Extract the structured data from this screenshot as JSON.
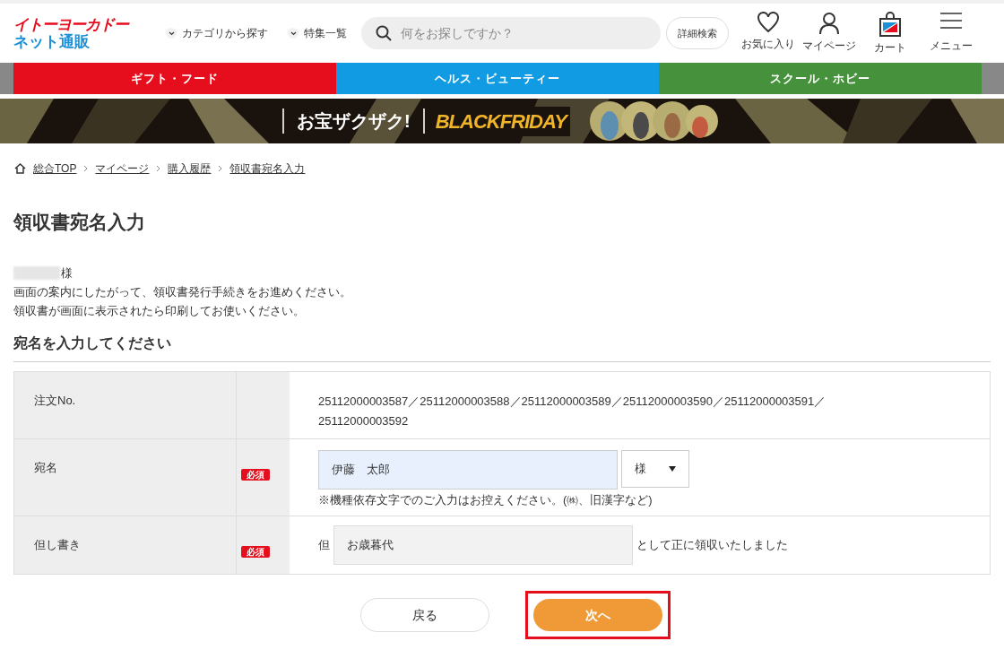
{
  "logo": {
    "line_1": "イトーヨーカドー",
    "line_2": "ネット通販"
  },
  "header": {
    "dropdowns": [
      "カテゴリから探す",
      "特集一覧"
    ],
    "search": {
      "placeholder": "何をお探しですか？"
    },
    "advanced_search": "詳細検索",
    "icons": [
      {
        "kind": "heart",
        "label": "お気に入り"
      },
      {
        "kind": "person",
        "label": "マイページ"
      },
      {
        "kind": "cart",
        "label": "カート"
      },
      {
        "kind": "menu",
        "label": "メニュー"
      }
    ]
  },
  "category_tabs": [
    {
      "label": "ギフト・フード",
      "color": "#e60d1c"
    },
    {
      "label": "ヘルス・ビューティー",
      "color": "#119be3"
    },
    {
      "label": "スクール・ホビー",
      "color": "#46913c"
    }
  ],
  "banner": {
    "tagline": "お宝ザクザク!",
    "title": "BLACKFRIDAY"
  },
  "breadcrumb": [
    "総合TOP",
    "マイページ",
    "購入履歴",
    "領収書宛名入力"
  ],
  "page_title": "領収書宛名入力",
  "greeting": {
    "honorific": "様",
    "lines": [
      "画面の案内にしたがって、領収書発行手続きをお進めください。",
      "領収書が画面に表示されたら印刷してお使いください。"
    ]
  },
  "section_title": "宛名を入力してください",
  "form_rows": [
    {
      "kind": "text",
      "label": "注文No.",
      "required": false,
      "lines": [
        "25112000003587／25112000003588／25112000003589／25112000003590／25112000003591／",
        "25112000003592"
      ]
    },
    {
      "kind": "name",
      "label": "宛名",
      "required": true,
      "required_label": "必須",
      "value": "伊藤　太郎",
      "select_value": "様",
      "note": "※機種依存文字でのご入力はお控えください。(㈱、旧漢字など)"
    },
    {
      "kind": "proviso",
      "label": "但し書き",
      "required": true,
      "required_label": "必須",
      "prefix": "但",
      "value": "お歳暮代",
      "suffix": "として正に領収いたしました"
    }
  ],
  "buttons": {
    "back": "戻る",
    "next": "次へ",
    "next_highlighted": true
  }
}
